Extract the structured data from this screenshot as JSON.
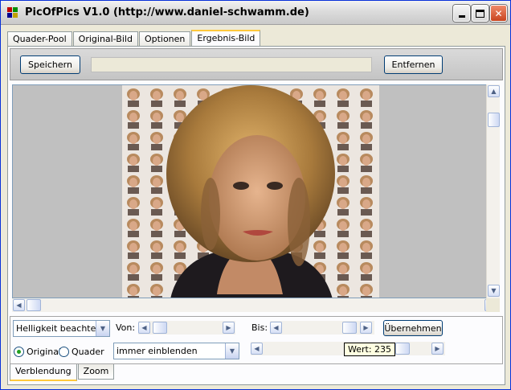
{
  "window": {
    "title": "PicOfPics V1.0 (http://www.daniel-schwamm.de)",
    "controls": [
      "minimize-icon",
      "maximize-icon",
      "close-icon"
    ]
  },
  "tabs": [
    {
      "label": "Quader-Pool",
      "active": false
    },
    {
      "label": "Original-Bild",
      "active": false
    },
    {
      "label": "Optionen",
      "active": false
    },
    {
      "label": "Ergebnis-Bild",
      "active": true
    }
  ],
  "toolbar": {
    "save_label": "Speichern",
    "path_value": "",
    "remove_label": "Entfernen"
  },
  "image": {
    "description": "",
    "tile_colors": [
      "#e8e2dc",
      "#c9a882",
      "#8a6a4a",
      "#f4f2f0"
    ]
  },
  "controls": {
    "brightness_select": "Helligkeit beachten",
    "from_label": "Von:",
    "to_label": "Bis:",
    "apply_label": "Übernehmen",
    "radio_original": "Original",
    "radio_quader": "Quader",
    "radio_selected": "original",
    "blend_select": "immer einblenden",
    "tooltip": "Wert: 235"
  },
  "bottom_tabs": [
    {
      "label": "Verblendung",
      "active": true
    },
    {
      "label": "Zoom",
      "active": false
    }
  ],
  "colors": {
    "accent": "#ffc83c",
    "window_border": "#0831d9"
  }
}
